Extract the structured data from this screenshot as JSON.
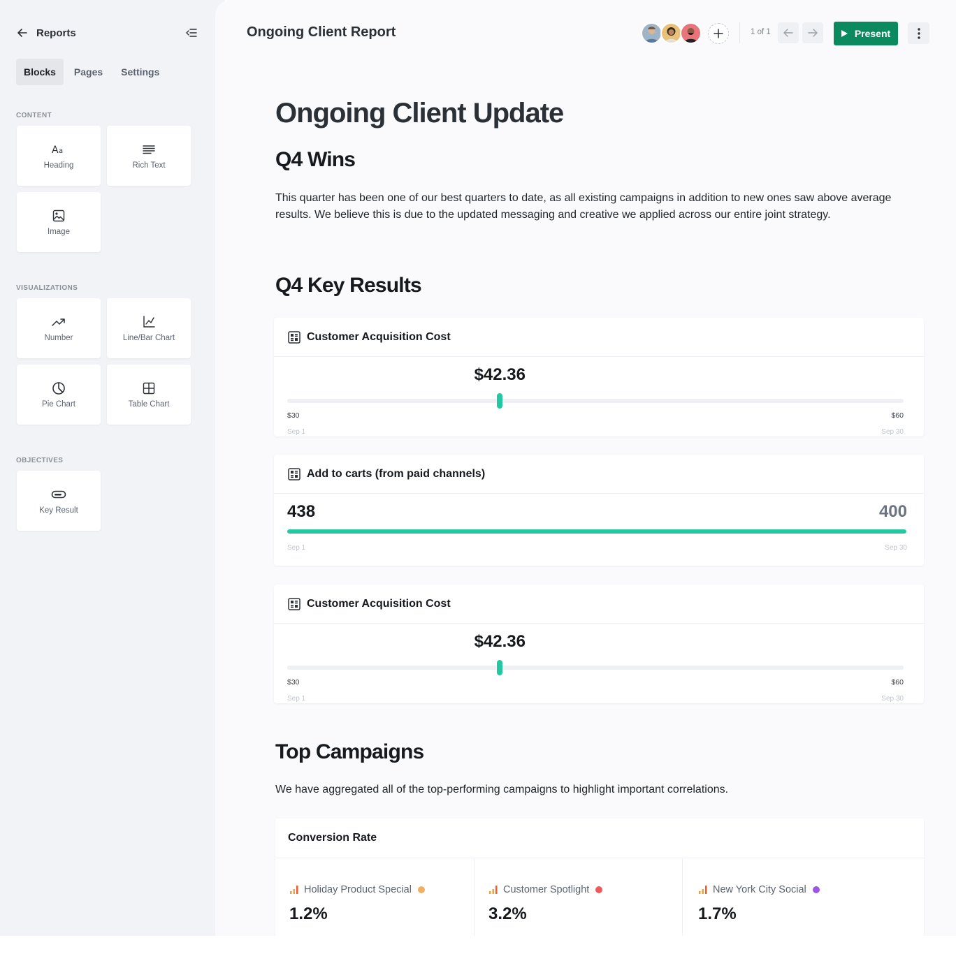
{
  "sidebar": {
    "title": "Reports",
    "tabs": [
      {
        "label": "Blocks",
        "active": true
      },
      {
        "label": "Pages",
        "active": false
      },
      {
        "label": "Settings",
        "active": false
      }
    ],
    "sections": {
      "content": {
        "label": "CONTENT",
        "blocks": [
          {
            "label": "Heading",
            "icon": "heading-icon"
          },
          {
            "label": "Rich Text",
            "icon": "rich-text-icon"
          },
          {
            "label": "Image",
            "icon": "image-icon"
          }
        ]
      },
      "visualizations": {
        "label": "VISUALIZATIONS",
        "blocks": [
          {
            "label": "Number",
            "icon": "trend-up-icon"
          },
          {
            "label": "Line/Bar Chart",
            "icon": "line-chart-icon"
          },
          {
            "label": "Pie Chart",
            "icon": "pie-chart-icon"
          },
          {
            "label": "Table Chart",
            "icon": "table-icon"
          }
        ]
      },
      "objectives": {
        "label": "OBJECTIVES",
        "blocks": [
          {
            "label": "Key Result",
            "icon": "key-result-icon"
          }
        ]
      }
    }
  },
  "topbar": {
    "title": "Ongoing Client Report",
    "pager": "1 of 1",
    "present_label": "Present",
    "accent": "#0c8a5f"
  },
  "document": {
    "title": "Ongoing Client Update",
    "wins": {
      "heading": "Q4 Wins",
      "body": "This quarter has been one of our best quarters to date, as all existing campaigns in addition to new ones saw above average results. We believe this is due to the updated messaging and creative we applied across our entire joint strategy."
    },
    "key_results": {
      "heading": "Q4 Key Results",
      "cards": [
        {
          "title": "Customer Acquisition Cost",
          "value": "$42.36",
          "min": "$30",
          "max": "$60",
          "position_fraction": 0.345,
          "start_date": "Sep 1",
          "end_date": "Sep 30"
        },
        {
          "title": "Add to carts (from paid channels)",
          "value": "438",
          "target": "400",
          "progress_fraction": 1.0,
          "start_date": "Sep 1",
          "end_date": "Sep 30"
        },
        {
          "title": "Customer Acquisition Cost",
          "value": "$42.36",
          "min": "$30",
          "max": "$60",
          "position_fraction": 0.345,
          "start_date": "Sep 1",
          "end_date": "Sep 30"
        }
      ],
      "bar_color": "#23c7a0"
    },
    "campaigns": {
      "heading": "Top Campaigns",
      "body": "We have aggregated all of the top-performing campaigns to highlight important correlations.",
      "conversion": {
        "title": "Conversion Rate",
        "items": [
          {
            "name": "Holiday Product Special",
            "value": "1.2%",
            "color": "#f0b064"
          },
          {
            "name": "Customer Spotlight",
            "value": "3.2%",
            "color": "#ee5a5a"
          },
          {
            "name": "New York City Social",
            "value": "1.7%",
            "color": "#9a57e6"
          }
        ]
      }
    }
  }
}
